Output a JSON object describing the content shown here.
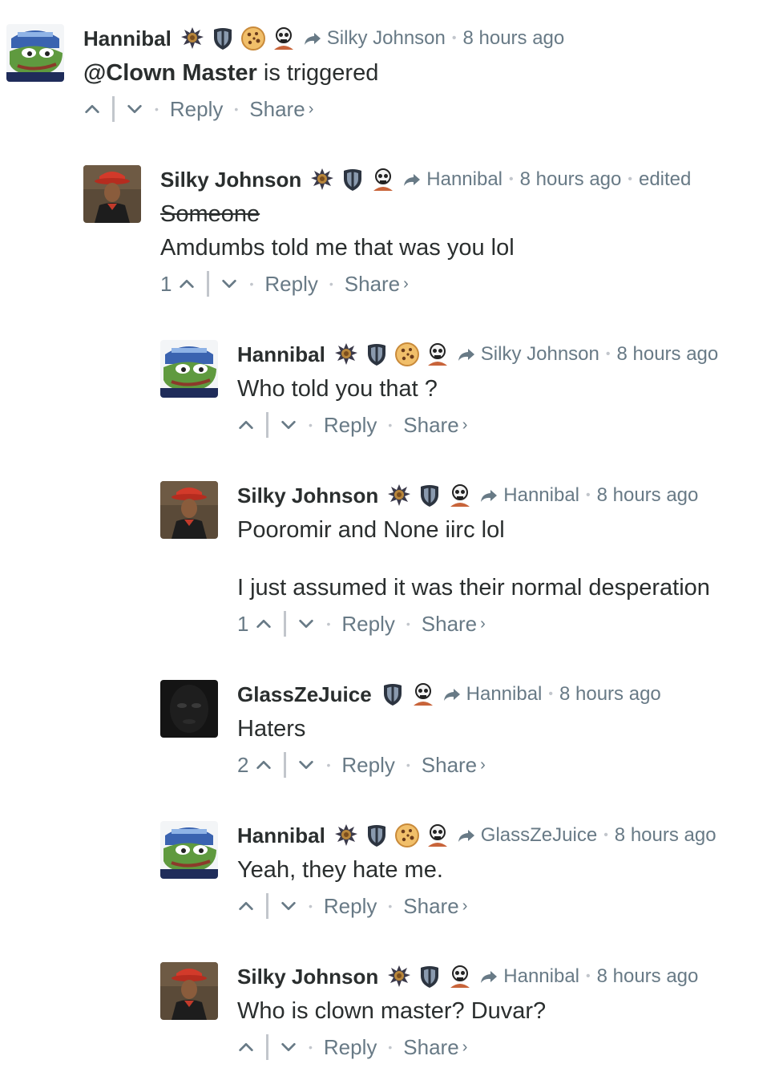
{
  "labels": {
    "reply": "Reply",
    "share": "Share",
    "edited": "edited"
  },
  "comments": [
    {
      "author": "Hannibal",
      "reply_to": "Silky Johnson",
      "time": "8 hours ago",
      "lines": [
        "is triggered"
      ],
      "mention": "@Clown Master",
      "votes": ""
    },
    {
      "author": "Silky Johnson",
      "reply_to": "Hannibal",
      "time": "8 hours ago",
      "edited": "edited",
      "strike": "Someone",
      "lines": [
        "Amdumbs told me that was you lol"
      ],
      "votes": "1"
    },
    {
      "author": "Hannibal",
      "reply_to": "Silky Johnson",
      "time": "8 hours ago",
      "lines": [
        "Who told you that ?"
      ],
      "votes": ""
    },
    {
      "author": "Silky Johnson",
      "reply_to": "Hannibal",
      "time": "8 hours ago",
      "lines": [
        "Pooromir and None iirc lol",
        "I just assumed it was their normal desperation"
      ],
      "votes": "1"
    },
    {
      "author": "GlassZeJuice",
      "reply_to": "Hannibal",
      "time": "8 hours ago",
      "lines": [
        "Haters"
      ],
      "votes": "2"
    },
    {
      "author": "Hannibal",
      "reply_to": "GlassZeJuice",
      "time": "8 hours ago",
      "lines": [
        "Yeah, they hate me."
      ],
      "votes": ""
    },
    {
      "author": "Silky Johnson",
      "reply_to": "Hannibal",
      "time": "8 hours ago",
      "lines": [
        "Who is clown master? Duvar?"
      ],
      "votes": ""
    }
  ],
  "icons": {
    "badge_crest": "crest-badge-icon",
    "badge_shield": "shield-badge-icon",
    "badge_cookie": "cookie-badge-icon",
    "badge_skull": "skull-badge-icon",
    "reply_arrow": "reply-arrow-icon",
    "upvote": "upvote-chevron-icon",
    "downvote": "downvote-chevron-icon"
  },
  "colors": {
    "text": "#2a2e2e",
    "muted": "#687a86",
    "divider": "#c2c6cc"
  }
}
